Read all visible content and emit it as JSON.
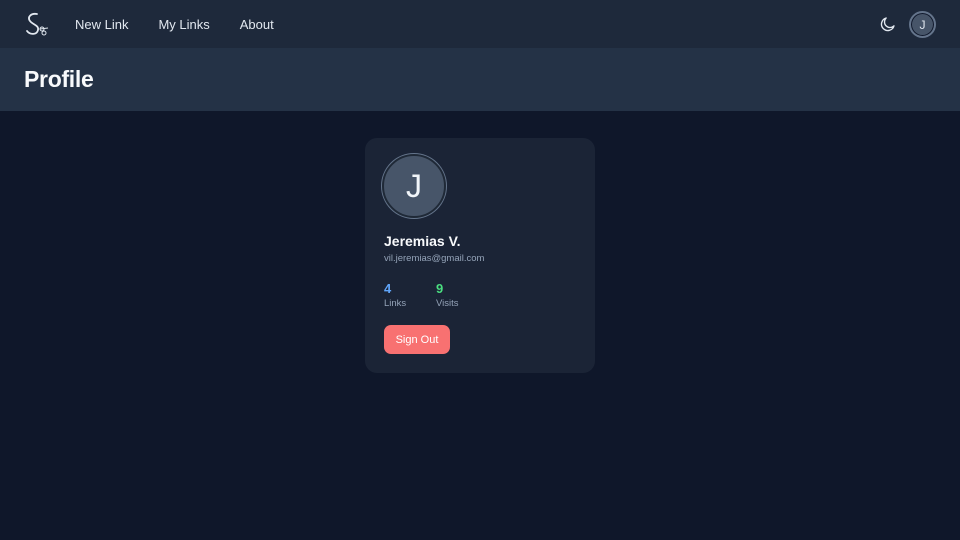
{
  "nav": {
    "logo_icon": "scissors-s-logo-icon",
    "links": [
      {
        "label": "New Link"
      },
      {
        "label": "My Links"
      },
      {
        "label": "About"
      }
    ],
    "theme_icon": "moon-icon",
    "avatar_initial": "J"
  },
  "header": {
    "title": "Profile"
  },
  "profile": {
    "avatar_initial": "J",
    "name": "Jeremias V.",
    "email": "vil.jeremias@gmail.com",
    "stats": [
      {
        "value": "4",
        "label": "Links",
        "color": "#60a5fa"
      },
      {
        "value": "9",
        "label": "Visits",
        "color": "#4ade80"
      }
    ],
    "signout_label": "Sign Out",
    "signout_color": "#f87171"
  },
  "colors": {
    "background": "#0f172a",
    "navbar": "#1e293b",
    "header": "#243246",
    "card": "#1b2436"
  }
}
